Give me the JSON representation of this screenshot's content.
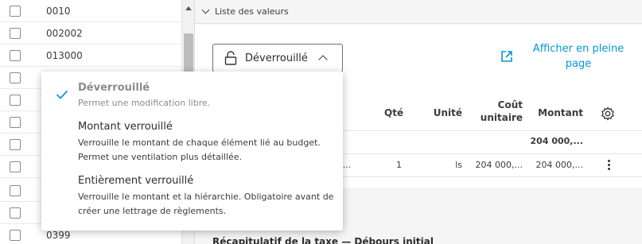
{
  "codes_list": {
    "rows": [
      "0010",
      "002002",
      "013000",
      "",
      "",
      "",
      "",
      "",
      "",
      "",
      "0399"
    ]
  },
  "section": {
    "title": "Liste des valeurs"
  },
  "lock_button": {
    "label": "Déverrouillé",
    "icon": "unlock-icon"
  },
  "fullscreen": {
    "label_line1": "Afficher en pleine",
    "label_line2": "page",
    "icon": "external-link-icon"
  },
  "table": {
    "headers": {
      "qty": "Qté",
      "unit": "Unité",
      "unit_cost_line1": "Coût",
      "unit_cost_line2": "unitaire",
      "amount": "Montant"
    },
    "total_row": {
      "amount": "204 000,..."
    },
    "rows": [
      {
        "desc_fragment": "s...",
        "qty": "1",
        "unit": "ls",
        "unit_cost": "204 000,...",
        "amount": "204 000,..."
      }
    ]
  },
  "bottom": {
    "text": "Récapitulatif de la taxe — Débours initial"
  },
  "menu": {
    "options": [
      {
        "title": "Déverrouillé",
        "desc1": "Permet une modification libre.",
        "desc2": "",
        "selected": true
      },
      {
        "title": "Montant verrouillé",
        "desc1": "Verrouille le montant de chaque élément lié au budget.",
        "desc2": "Permet une ventilation plus détaillée.",
        "selected": false
      },
      {
        "title": "Entièrement verrouillé",
        "desc1": "Verrouille le montant et la hiérarchie. Obligatoire avant de",
        "desc2": "créer une lettrage de règlements.",
        "selected": false
      }
    ]
  },
  "colors": {
    "accent": "#0696d7",
    "muted": "#8c8c8c",
    "text": "#3c3c3c"
  }
}
